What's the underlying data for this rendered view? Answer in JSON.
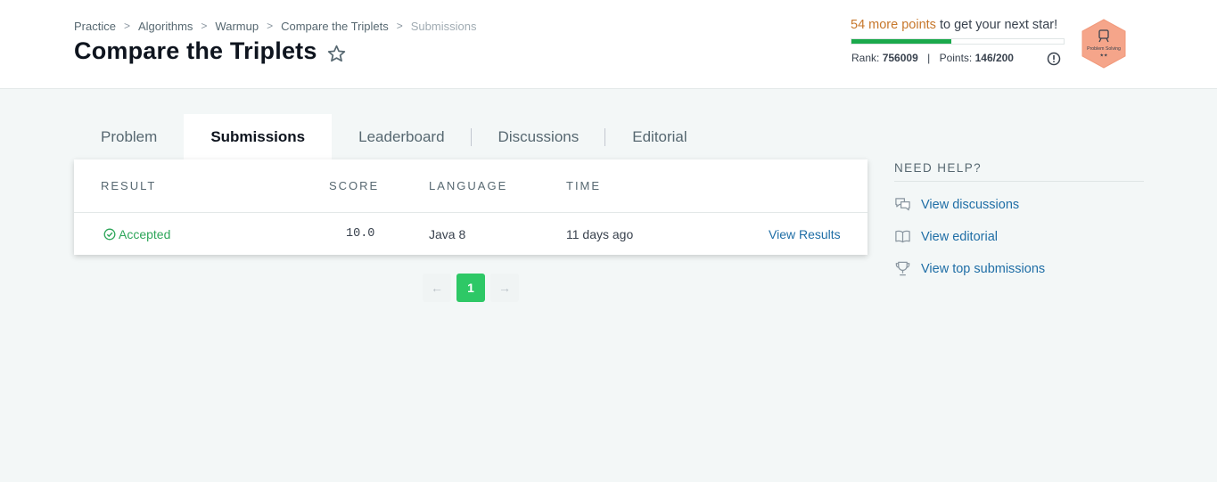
{
  "breadcrumb": {
    "items": [
      "Practice",
      "Algorithms",
      "Warmup",
      "Compare the Triplets"
    ],
    "current": "Submissions"
  },
  "page_title": "Compare the Triplets",
  "progress": {
    "points_text": "54 more points",
    "rest_text": " to get your next star!",
    "fraction": 0.47,
    "rank_label": "Rank:",
    "rank_value": "756009",
    "points_label": "Points:",
    "points_value": "146/200",
    "badge_title": "Problem Solving",
    "badge_stars": "★★"
  },
  "tabs": [
    {
      "label": "Problem"
    },
    {
      "label": "Submissions"
    },
    {
      "label": "Leaderboard"
    },
    {
      "label": "Discussions"
    },
    {
      "label": "Editorial"
    }
  ],
  "table": {
    "headers": {
      "result": "RESULT",
      "score": "SCORE",
      "language": "LANGUAGE",
      "time": "TIME"
    },
    "rows": [
      {
        "result": "Accepted",
        "score": "10.0",
        "language": "Java 8",
        "time": "11 days ago",
        "action": "View Results"
      }
    ]
  },
  "pager": {
    "prev": "←",
    "current": "1",
    "next": "→"
  },
  "help": {
    "title": "NEED HELP?",
    "items": [
      {
        "label": "View discussions",
        "icon": "discussion-icon"
      },
      {
        "label": "View editorial",
        "icon": "book-icon"
      },
      {
        "label": "View top submissions",
        "icon": "trophy-icon"
      }
    ]
  },
  "colors": {
    "accent_green": "#1ba94c",
    "accepted_green": "#2ea65a",
    "link_blue": "#1f6ea6",
    "points_orange": "#c7772b",
    "badge_orange": "#f5a58a"
  }
}
